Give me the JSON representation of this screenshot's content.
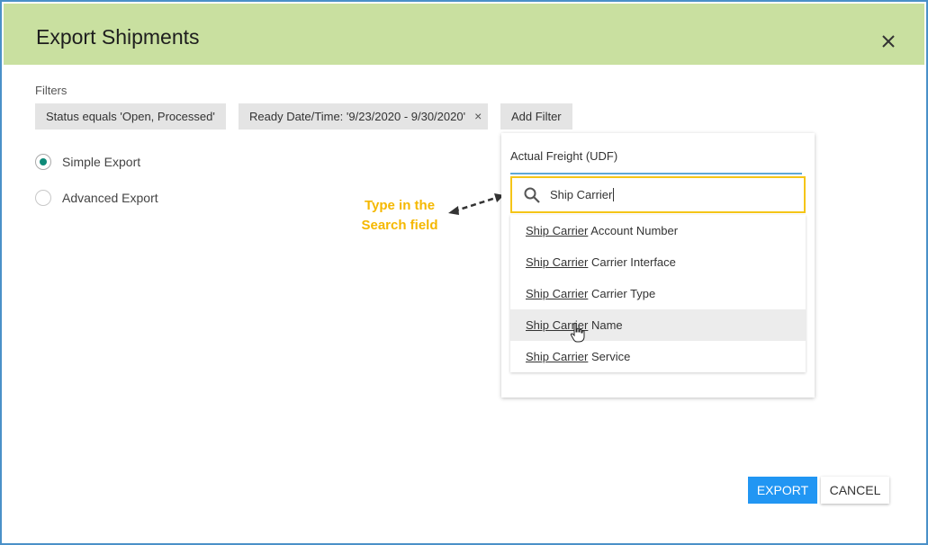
{
  "dialog": {
    "title": "Export Shipments",
    "close_icon": "close-icon"
  },
  "filters": {
    "label": "Filters",
    "chips": [
      {
        "text": "Status equals 'Open, Processed'"
      },
      {
        "text": "Ready Date/Time: '9/23/2020 - 9/30/2020'",
        "remove_glyph": "×"
      }
    ],
    "add_label": "Add Filter"
  },
  "export_mode": {
    "options": [
      {
        "label": "Simple Export",
        "selected": true
      },
      {
        "label": "Advanced Export",
        "selected": false
      }
    ]
  },
  "annotation": {
    "line1": "Type in the",
    "line2": "Search field",
    "color": "#f5b800"
  },
  "add_filter_panel": {
    "selected_field": "Actual Freight (UDF)",
    "search_value": "Ship Carrier",
    "search_icon": "search-icon",
    "results": [
      {
        "match": "Ship Carrier",
        "rest": " Account Number"
      },
      {
        "match": "Ship Carrier",
        "rest": " Carrier Interface"
      },
      {
        "match": "Ship Carrier",
        "rest": " Carrier Type"
      },
      {
        "match": "Ship Carrier",
        "rest": " Name",
        "hovered": true
      },
      {
        "match": "Ship Carrier",
        "rest": " Service"
      }
    ]
  },
  "buttons": {
    "export": "EXPORT",
    "cancel": "CANCEL"
  },
  "colors": {
    "header_bg": "#c9e0a0",
    "primary": "#2196f3",
    "radio_selected": "#0e8a78",
    "highlight_border": "#f5c518"
  }
}
